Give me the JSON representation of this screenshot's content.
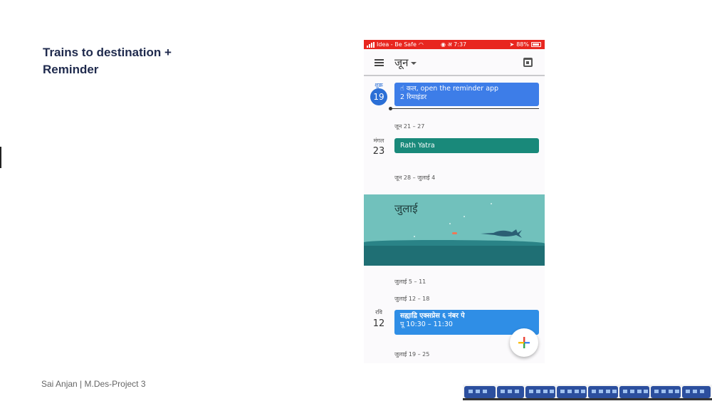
{
  "slide": {
    "title_line1": "Trains to destination +",
    "title_line2": "Reminder",
    "footer": "Sai Anjan | M.Des-Project 3"
  },
  "status_bar": {
    "carrier": "Idea - Be Safe",
    "time": "अ 7:37",
    "battery": "88%"
  },
  "app_bar": {
    "month": "जून",
    "icons": [
      "menu-icon",
      "calendar-icon"
    ]
  },
  "schedule": {
    "day1": {
      "weekday": "शुक्र",
      "date": "19",
      "event_line1": "कल, open the reminder app",
      "event_line2": "2 रिमाइंडर"
    },
    "week1": "जून 21 – 27",
    "day2": {
      "weekday": "मंगल",
      "date": "23",
      "event": "Rath Yatra"
    },
    "week2": "जून 28 – जुलाई 4",
    "banner_month": "जुलाई",
    "week3": "जुलाई 5 – 11",
    "week4": "जुलाई 12 – 18",
    "day3": {
      "weekday": "रवि",
      "date": "12",
      "event_line1": "सह्याद्रि एक्सप्रेस ६ नंबर पे",
      "event_line2": "पू 10:30 – 11:30"
    },
    "week5": "जुलाई 19 – 25"
  },
  "colors": {
    "status_bar": "#e8261f",
    "accent_blue": "#3d7de8",
    "event_green": "#19897a",
    "title_navy": "#1f2a4d"
  }
}
